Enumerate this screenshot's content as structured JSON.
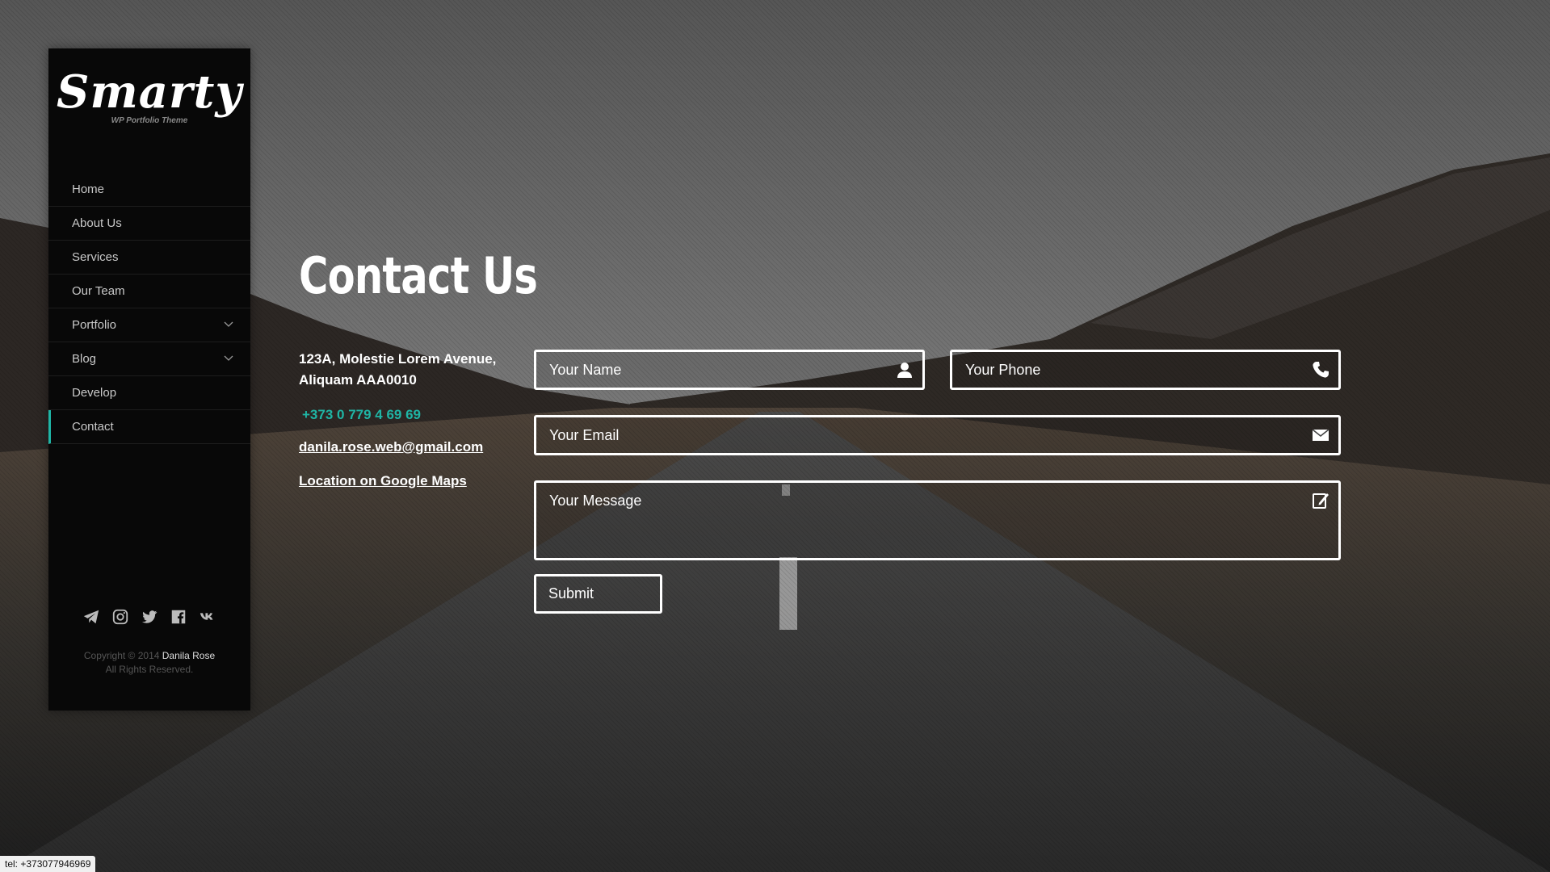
{
  "sidebar": {
    "logo": {
      "title": "Smarty",
      "subtitle": "WP Portfolio Theme"
    },
    "nav": [
      {
        "label": "Home",
        "has_submenu": false,
        "active": false
      },
      {
        "label": "About Us",
        "has_submenu": false,
        "active": false
      },
      {
        "label": "Services",
        "has_submenu": false,
        "active": false
      },
      {
        "label": "Our Team",
        "has_submenu": false,
        "active": false
      },
      {
        "label": "Portfolio",
        "has_submenu": true,
        "active": false
      },
      {
        "label": "Blog",
        "has_submenu": true,
        "active": false
      },
      {
        "label": "Develop",
        "has_submenu": false,
        "active": false
      },
      {
        "label": "Contact",
        "has_submenu": false,
        "active": true
      }
    ],
    "social_icons": [
      "telegram-icon",
      "instagram-icon",
      "twitter-icon",
      "facebook-icon",
      "vk-icon"
    ],
    "copyright": {
      "prefix": "Copyright © 2014",
      "author": "Danila Rose",
      "rights": "All Rights Reserved."
    }
  },
  "main": {
    "title": "Contact Us",
    "contact": {
      "address_line1": "123A, Molestie Lorem Avenue,",
      "address_line2": "Aliquam AAA0010",
      "phone": "+373 0 779 4 69 69",
      "email": "danila.rose.web@gmail.com",
      "maps_link": "Location on Google Maps"
    },
    "form": {
      "name_placeholder": "Your Name",
      "phone_placeholder": "Your Phone",
      "email_placeholder": "Your Email",
      "message_placeholder": "Your Message",
      "submit_label": "Submit"
    }
  },
  "status_bar": {
    "text": "tel: +373077946969"
  },
  "colors": {
    "accent": "#1fb5a5",
    "sidebar_bg": "#080808",
    "text": "#ffffff"
  }
}
